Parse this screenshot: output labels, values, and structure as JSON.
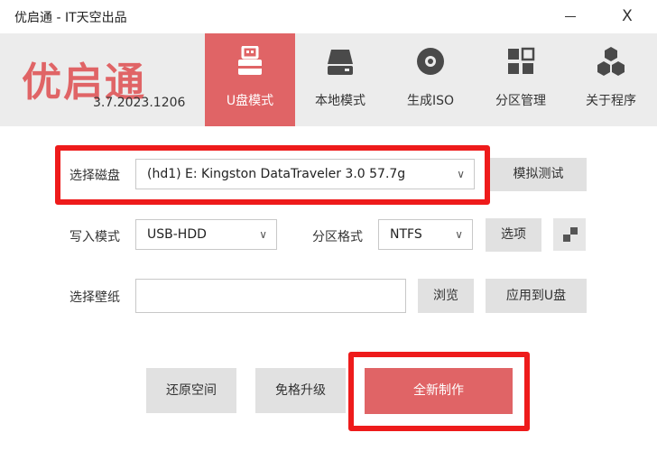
{
  "window": {
    "title": "优启通 - IT天空出品",
    "minimize_label": "",
    "close_label": "X"
  },
  "header": {
    "logo_text": "优启通",
    "version": "3.7.2023.1206"
  },
  "nav": {
    "items": [
      {
        "label": "U盘模式",
        "icon": "usb-drive-icon",
        "active": true
      },
      {
        "label": "本地模式",
        "icon": "hard-disk-icon",
        "active": false
      },
      {
        "label": "生成ISO",
        "icon": "disc-icon",
        "active": false
      },
      {
        "label": "分区管理",
        "icon": "partition-grid-icon",
        "active": false
      },
      {
        "label": "关于程序",
        "icon": "hexagons-icon",
        "active": false
      }
    ]
  },
  "form": {
    "disk_label": "选择磁盘",
    "disk_value": "(hd1) E: Kingston DataTraveler 3.0 57.7g",
    "simulate_button": "模拟测试",
    "write_mode_label": "写入模式",
    "write_mode_value": "USB-HDD",
    "partition_format_label": "分区格式",
    "partition_format_value": "NTFS",
    "options_button": "选项",
    "wallpaper_label": "选择壁纸",
    "wallpaper_value": "",
    "browse_button": "浏览",
    "apply_button": "应用到U盘"
  },
  "actions": {
    "restore_space": "还原空间",
    "upgrade_no_format": "免格升级",
    "create_new": "全新制作"
  },
  "colors": {
    "accent": "#e06466",
    "highlight_frame": "#ee1b1b",
    "header_bg": "#ececec",
    "button_bg": "#e1e1e1"
  }
}
